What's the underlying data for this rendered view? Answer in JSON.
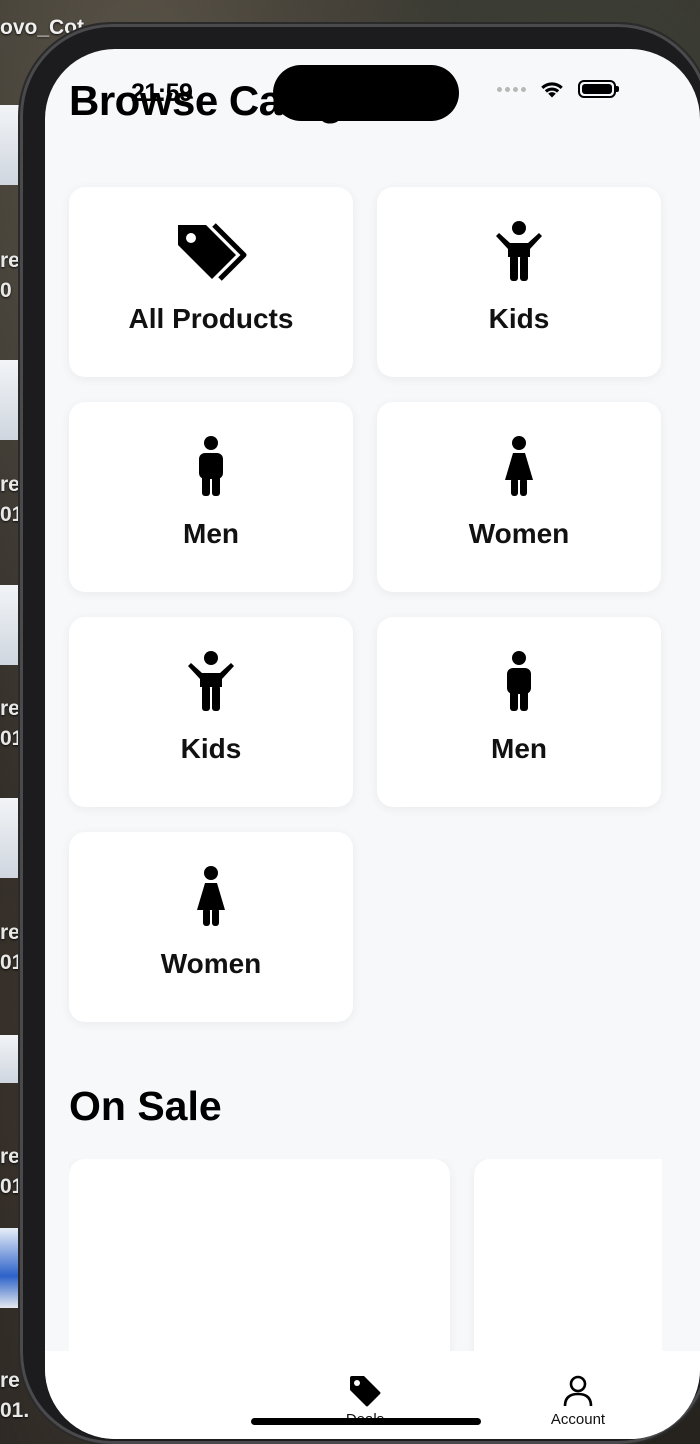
{
  "desktop": {
    "window_title": "ovo_Cot",
    "labels": [
      "re\n0",
      "re\n01",
      "re\n01",
      "re\n01",
      "re\n01",
      "re\n01."
    ]
  },
  "status_bar": {
    "time": "21:59"
  },
  "page": {
    "title": "Browse Categories"
  },
  "categories": [
    {
      "label": "All Products",
      "icon": "tags-icon"
    },
    {
      "label": "Kids",
      "icon": "child-icon"
    },
    {
      "label": "Men",
      "icon": "man-icon"
    },
    {
      "label": "Women",
      "icon": "woman-icon"
    },
    {
      "label": "Kids",
      "icon": "child-icon"
    },
    {
      "label": "Men",
      "icon": "man-icon"
    },
    {
      "label": "Women",
      "icon": "woman-icon"
    }
  ],
  "on_sale": {
    "title": "On Sale"
  },
  "tab_bar": {
    "tabs": [
      {
        "label": "Deals",
        "icon": "tag-icon"
      },
      {
        "label": "Account",
        "icon": "person-icon"
      }
    ]
  },
  "colors": {
    "screen_background": "#f7f8fa",
    "card_background": "#ffffff",
    "text": "#000000"
  }
}
